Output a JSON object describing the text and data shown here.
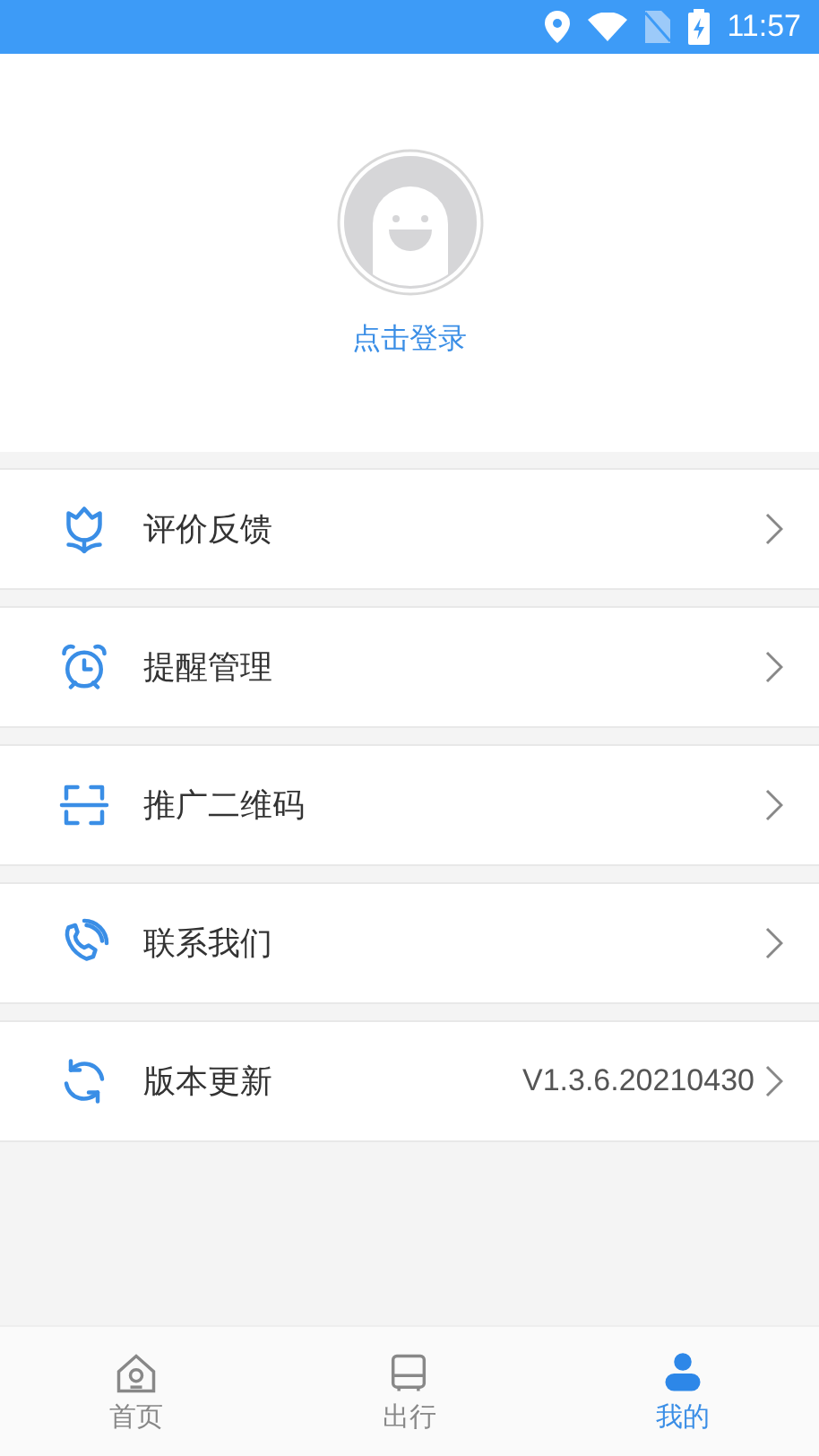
{
  "status_bar": {
    "time": "11:57"
  },
  "profile": {
    "login_text": "点击登录"
  },
  "menu": [
    {
      "label": "评价反馈"
    },
    {
      "label": "提醒管理"
    },
    {
      "label": "推广二维码"
    },
    {
      "label": "联系我们"
    },
    {
      "label": "版本更新",
      "value": "V1.3.6.20210430"
    }
  ],
  "tabs": [
    {
      "label": "首页",
      "selected": false
    },
    {
      "label": "出行",
      "selected": false
    },
    {
      "label": "我的",
      "selected": true
    }
  ]
}
